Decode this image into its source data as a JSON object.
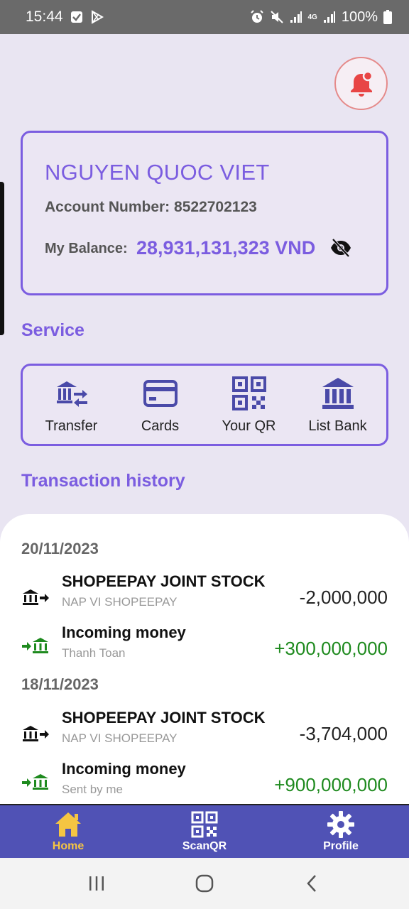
{
  "status_bar": {
    "time": "15:44",
    "battery": "100%",
    "network": "4G"
  },
  "account": {
    "name": "NGUYEN QUOC VIET",
    "number_label": "Account Number:",
    "number": "8522702123",
    "balance_label": "My Balance:",
    "balance": "28,931,131,323 VND"
  },
  "service": {
    "title": "Service",
    "items": [
      {
        "label": "Transfer",
        "icon": "transfer-icon"
      },
      {
        "label": "Cards",
        "icon": "card-icon"
      },
      {
        "label": "Your QR",
        "icon": "qr-icon"
      },
      {
        "label": "List Bank",
        "icon": "bank-icon"
      }
    ]
  },
  "history": {
    "title": "Transaction history",
    "groups": [
      {
        "date": "20/11/2023",
        "transactions": [
          {
            "title": "SHOPEEPAY JOINT STOCK",
            "subtitle": "NAP VI SHOPEEPAY",
            "amount": "-2,000,000",
            "direction": "out"
          },
          {
            "title": "Incoming money",
            "subtitle": "Thanh Toan",
            "amount": "+300,000,000",
            "direction": "in"
          }
        ]
      },
      {
        "date": "18/11/2023",
        "transactions": [
          {
            "title": "SHOPEEPAY JOINT STOCK",
            "subtitle": "NAP VI SHOPEEPAY",
            "amount": "-3,704,000",
            "direction": "out"
          },
          {
            "title": "Incoming money",
            "subtitle": "Sent by me",
            "amount": "+900,000,000",
            "direction": "in"
          }
        ]
      }
    ]
  },
  "bottom_nav": {
    "items": [
      {
        "label": "Home",
        "icon": "home-icon",
        "active": true
      },
      {
        "label": "ScanQR",
        "icon": "qr-scan-icon",
        "active": false
      },
      {
        "label": "Profile",
        "icon": "gear-icon",
        "active": false
      }
    ]
  },
  "colors": {
    "accent": "#7b5de0",
    "nav_bg": "#5052b5",
    "active_nav": "#f5c542",
    "positive": "#1e8a1e",
    "bell": "#e84545"
  }
}
